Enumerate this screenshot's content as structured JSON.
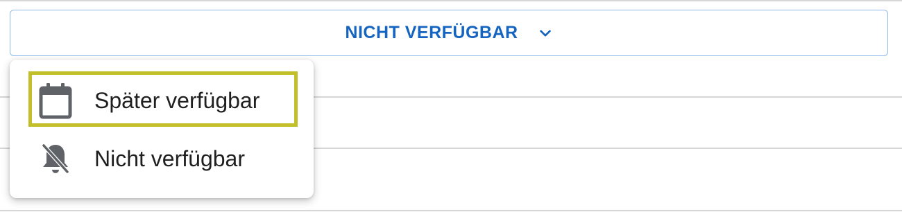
{
  "dropdown": {
    "label": "NICHT VERFÜGBAR",
    "icon": "chevron-down-icon",
    "accent_color": "#1565c0",
    "border_color": "#8fb8ea"
  },
  "menu": {
    "items": [
      {
        "label": "Später verfügbar",
        "icon": "calendar-icon",
        "highlighted": true
      },
      {
        "label": "Nicht verfügbar",
        "icon": "bell-off-icon",
        "highlighted": false
      }
    ]
  },
  "colors": {
    "highlight": "#c2bf2a",
    "text": "#1f1f1f",
    "icon": "#5f6368"
  }
}
